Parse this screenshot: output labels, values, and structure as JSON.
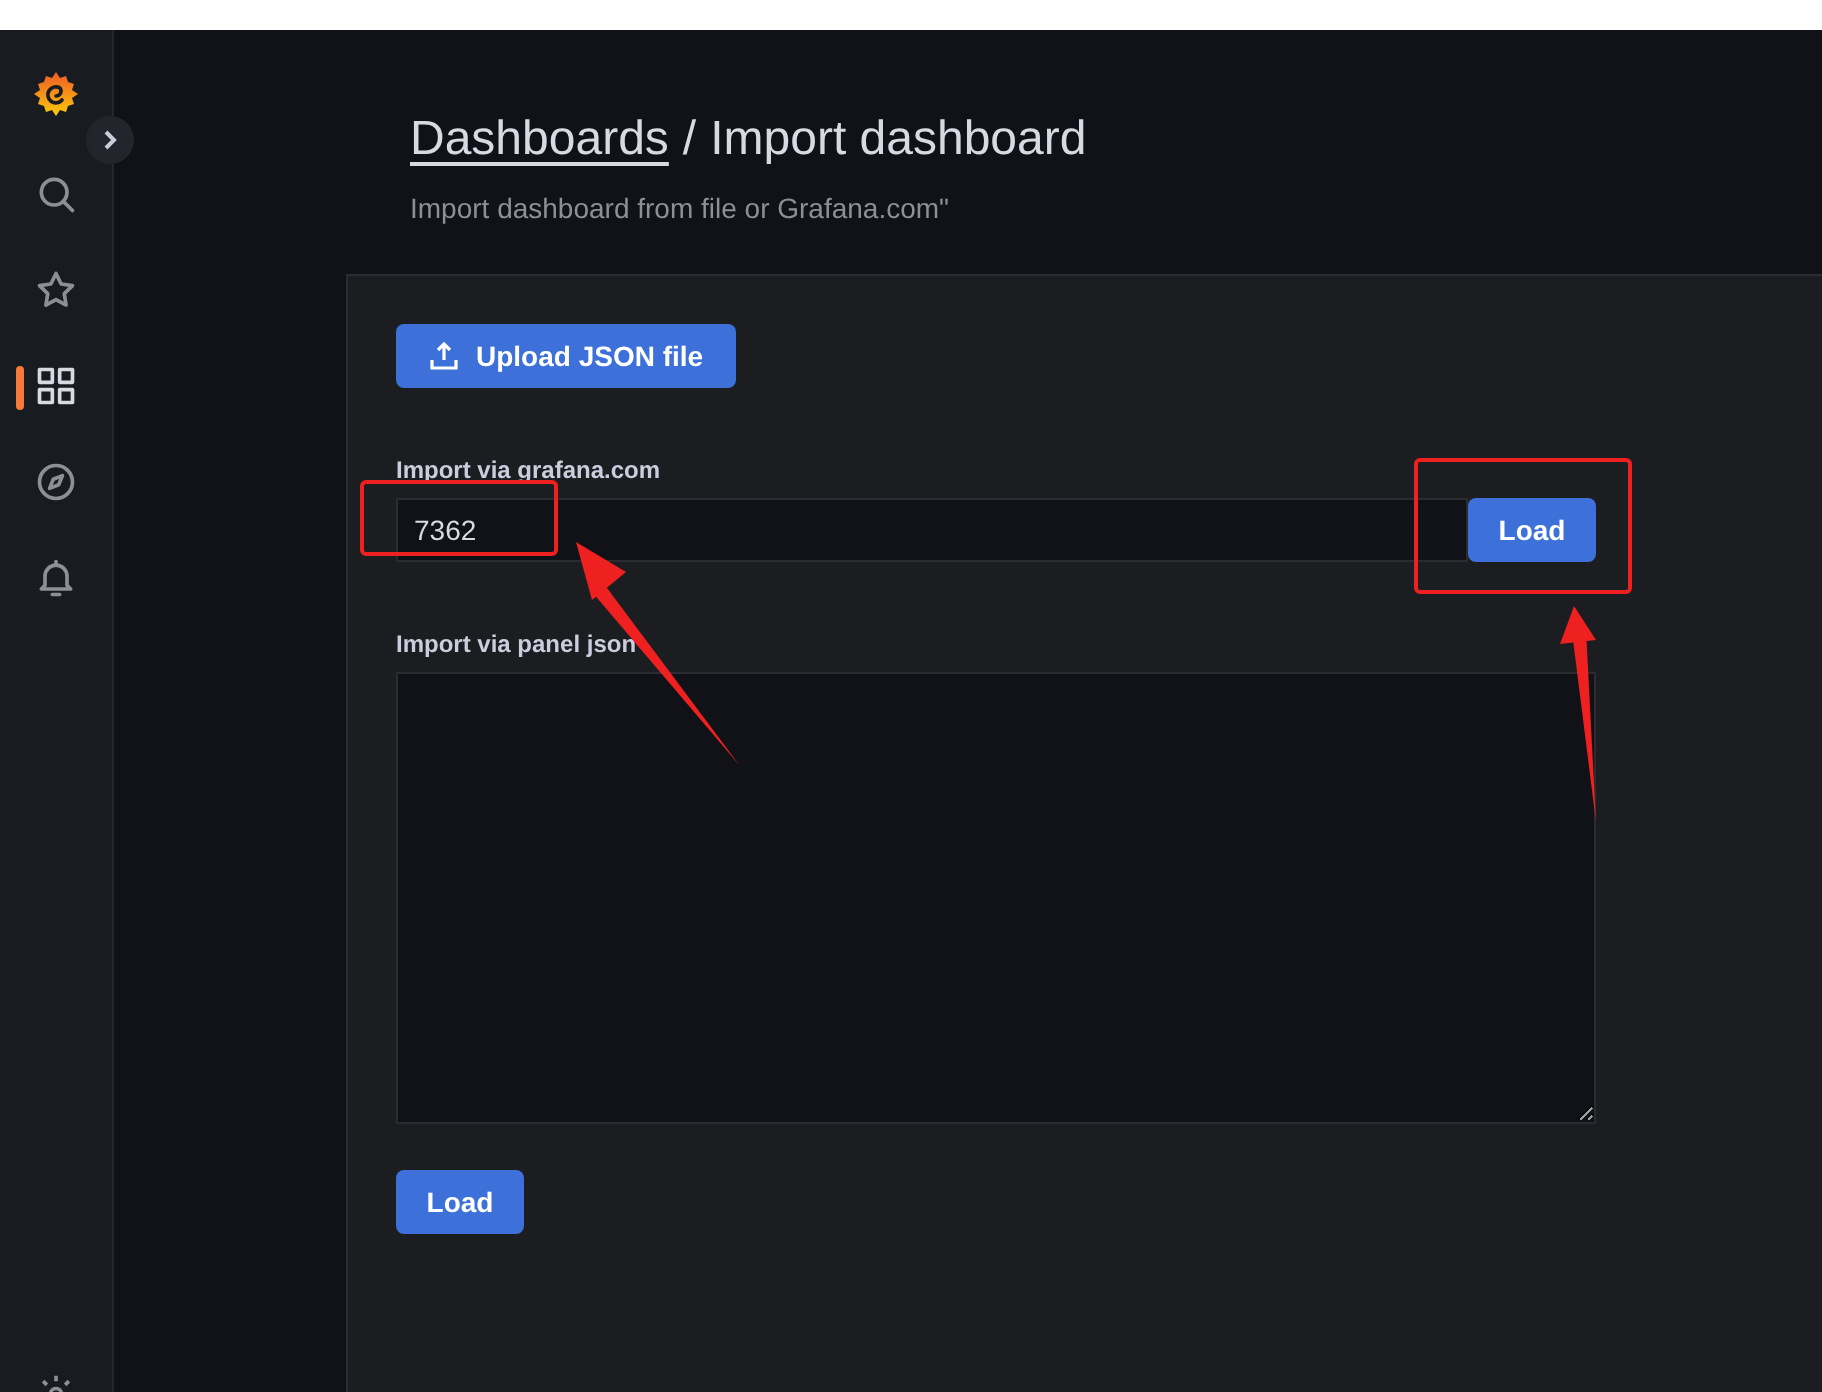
{
  "sidebar": {
    "items": [
      {
        "kind": "search",
        "selected": false
      },
      {
        "kind": "starred",
        "selected": false
      },
      {
        "kind": "dashboards",
        "selected": true
      },
      {
        "kind": "explore",
        "selected": false
      },
      {
        "kind": "alerting",
        "selected": false
      }
    ]
  },
  "breadcrumb": {
    "parent": "Dashboards",
    "separator": "/",
    "title": "Import dashboard"
  },
  "subtitle": "Import dashboard from file or Grafana.com\"",
  "upload_button": "Upload JSON file",
  "grafana_import": {
    "label": "Import via grafana.com",
    "value": "7362",
    "button": "Load"
  },
  "panel_json": {
    "label": "Import via panel json"
  },
  "load_button": "Load"
}
